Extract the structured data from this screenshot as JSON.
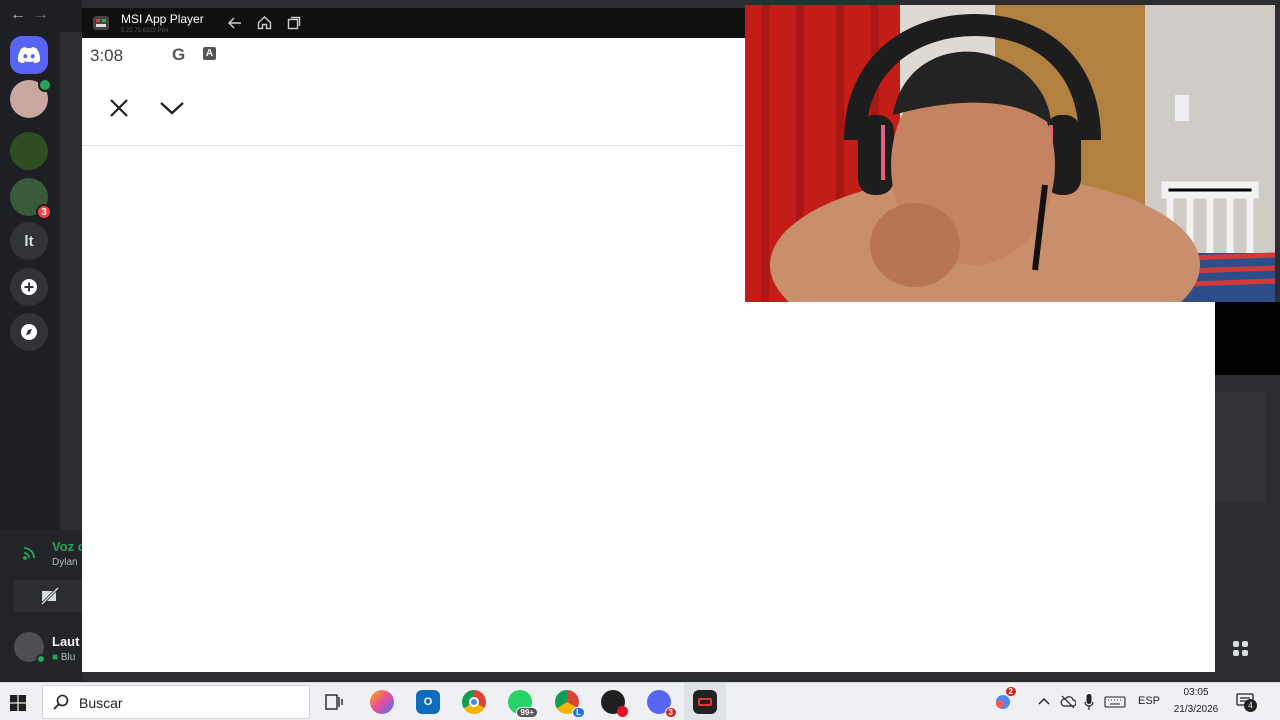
{
  "discord": {
    "nav_back": "←",
    "nav_forward": "→",
    "guild_text": "lt",
    "guild_badge_1": "3",
    "voice_status": "Voz c",
    "voice_channel": "Dylan",
    "user_name": "Laut",
    "user_status": "Blu"
  },
  "emulator": {
    "title": "MSI App Player",
    "subtitle": "5.22.75.6322 P64",
    "status_time": "3:08"
  },
  "taskbar": {
    "search_placeholder": "Buscar",
    "whatsapp_badge": "99+",
    "chrome_profile_badge": "L",
    "discord_badge": "3",
    "copilot_badge": "2",
    "lang": "ESP",
    "time": "03:05",
    "date": "21/3/2026",
    "notifications_badge": "4"
  },
  "colors": {
    "discord_blurple": "#5865f2",
    "discord_bg": "#2b2d31",
    "discord_rail": "#1e1f22",
    "discord_green": "#23a55a",
    "taskbar_bg": "#eef0f3"
  }
}
